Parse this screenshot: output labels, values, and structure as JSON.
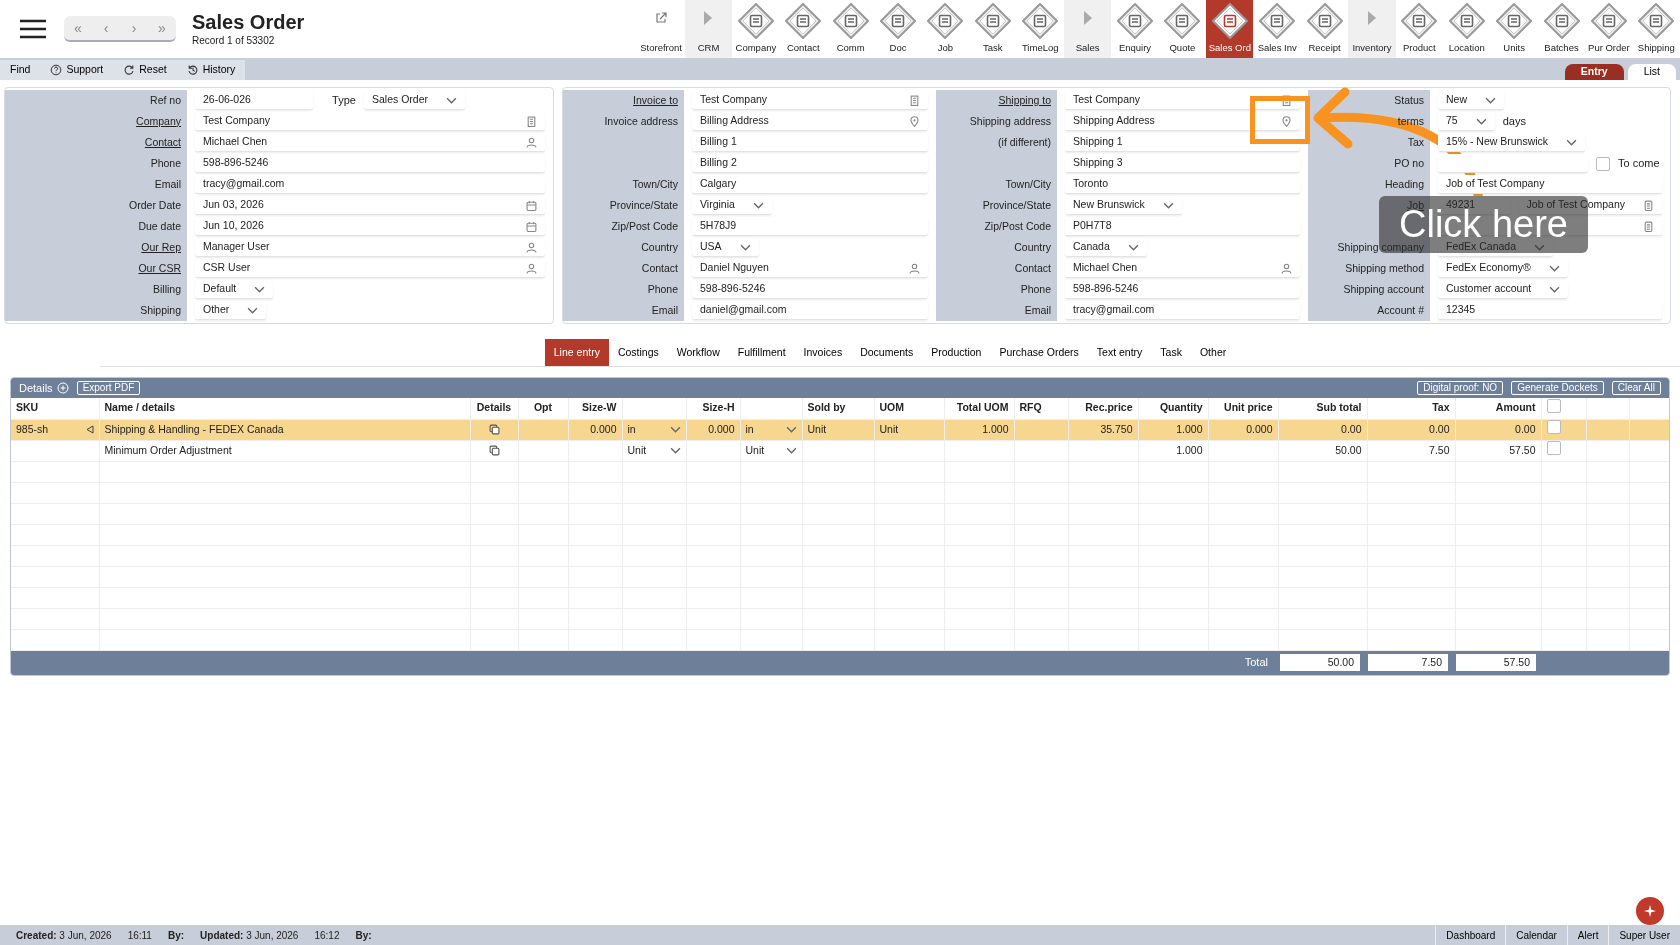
{
  "app": {
    "title": "Sales Order",
    "record": "Record 1 of 53302"
  },
  "nav_buttons": [
    "«",
    "‹",
    "›",
    "»"
  ],
  "toolbar": [
    {
      "label": "Storefront",
      "kind": "link",
      "selected": false
    },
    {
      "label": "CRM",
      "kind": "section",
      "selected": false
    },
    {
      "label": "Company",
      "kind": "module",
      "selected": false
    },
    {
      "label": "Contact",
      "kind": "module",
      "selected": false
    },
    {
      "label": "Comm",
      "kind": "module",
      "selected": false
    },
    {
      "label": "Doc",
      "kind": "module",
      "selected": false
    },
    {
      "label": "Job",
      "kind": "module",
      "selected": false
    },
    {
      "label": "Task",
      "kind": "module",
      "selected": false
    },
    {
      "label": "TimeLog",
      "kind": "module",
      "selected": false
    },
    {
      "label": "Sales",
      "kind": "section",
      "selected": false
    },
    {
      "label": "Enquiry",
      "kind": "module",
      "selected": false
    },
    {
      "label": "Quote",
      "kind": "module",
      "selected": false
    },
    {
      "label": "Sales Ord",
      "kind": "module",
      "selected": true
    },
    {
      "label": "Sales Inv",
      "kind": "module",
      "selected": false
    },
    {
      "label": "Receipt",
      "kind": "module",
      "selected": false
    },
    {
      "label": "Inventory",
      "kind": "section",
      "selected": false
    },
    {
      "label": "Product",
      "kind": "module",
      "selected": false
    },
    {
      "label": "Location",
      "kind": "module",
      "selected": false
    },
    {
      "label": "Units",
      "kind": "module",
      "selected": false
    },
    {
      "label": "Batches",
      "kind": "module",
      "selected": false
    },
    {
      "label": "Pur Order",
      "kind": "module",
      "selected": false
    },
    {
      "label": "Shipping",
      "kind": "module",
      "selected": false
    }
  ],
  "actions": [
    {
      "label": "Find",
      "kind": "plain"
    },
    {
      "label": "Support",
      "kind": "help"
    },
    {
      "label": "Reset",
      "kind": "reset"
    },
    {
      "label": "History",
      "kind": "history"
    }
  ],
  "view_tabs": [
    {
      "label": "Entry",
      "selected": true
    },
    {
      "label": "List",
      "selected": false
    }
  ],
  "form": {
    "general": [
      {
        "label": "Ref no",
        "value": "26-06-026",
        "kind": "text",
        "extra": {
          "label": "Type",
          "value": "Sales Order",
          "kind": "select"
        }
      },
      {
        "label": "Company",
        "link": true,
        "value": "Test Company",
        "kind": "company"
      },
      {
        "label": "Contact",
        "link": true,
        "value": "Michael Chen",
        "kind": "person"
      },
      {
        "label": "Phone",
        "value": "598-896-5246",
        "kind": "text"
      },
      {
        "label": "Email",
        "value": "tracy@gmail.com",
        "kind": "text"
      },
      {
        "label": "Order Date",
        "value": "Jun 03, 2026",
        "kind": "date"
      },
      {
        "label": "Due date",
        "value": "Jun 10, 2026",
        "kind": "date"
      },
      {
        "label": "Our Rep",
        "link": true,
        "value": "Manager User",
        "kind": "person"
      },
      {
        "label": "Our CSR",
        "link": true,
        "value": "CSR User",
        "kind": "person"
      },
      {
        "label": "Billing",
        "value": "Default",
        "kind": "select"
      },
      {
        "label": "Shipping",
        "value": "Other",
        "kind": "select"
      }
    ],
    "invoice": [
      {
        "label": "Invoice to",
        "link": true,
        "value": "Test Company",
        "kind": "company"
      },
      {
        "label": "Invoice address",
        "value": "Billing Address",
        "kind": "address"
      },
      {
        "value": "Billing 1",
        "kind": "text"
      },
      {
        "value": "Billing 2",
        "kind": "text"
      },
      {
        "label": "Town/City",
        "value": "Calgary",
        "kind": "text"
      },
      {
        "label": "Province/State",
        "value": "Virginia",
        "kind": "select"
      },
      {
        "label": "Zip/Post Code",
        "value": "5H78J9",
        "kind": "text"
      },
      {
        "label": "Country",
        "value": "USA",
        "kind": "select"
      },
      {
        "label": "Contact",
        "value": "Daniel Nguyen",
        "kind": "person"
      },
      {
        "label": "Phone",
        "value": "598-896-5246",
        "kind": "text"
      },
      {
        "label": "Email",
        "value": "daniel@gmail.com",
        "kind": "text"
      }
    ],
    "shipping": [
      {
        "label": "Shipping to",
        "link": true,
        "value": "Test Company",
        "kind": "company"
      },
      {
        "label": "Shipping address",
        "value": "Shipping Address",
        "kind": "address"
      },
      {
        "label": "(if different)",
        "value": "Shipping 1",
        "kind": "text"
      },
      {
        "value": "Shipping 3",
        "kind": "text"
      },
      {
        "label": "Town/City",
        "value": "Toronto",
        "kind": "text"
      },
      {
        "label": "Province/State",
        "value": "New Brunswick",
        "kind": "select"
      },
      {
        "label": "Zip/Post Code",
        "value": "P0H7T8",
        "kind": "text"
      },
      {
        "label": "Country",
        "value": "Canada",
        "kind": "select"
      },
      {
        "label": "Contact",
        "value": "Michael Chen",
        "kind": "person"
      },
      {
        "label": "Phone",
        "value": "598-896-5246",
        "kind": "text"
      },
      {
        "label": "Email",
        "value": "tracy@gmail.com",
        "kind": "text"
      }
    ],
    "status": [
      {
        "label": "Status",
        "value": "New",
        "kind": "select"
      },
      {
        "label": "terms",
        "value": "75",
        "kind": "select",
        "suffix": "days"
      },
      {
        "label": "Tax",
        "value": "15% - New Brunswick",
        "kind": "select"
      },
      {
        "label": "PO no",
        "kind": "short",
        "extra": {
          "label": "To come",
          "kind": "checkbox",
          "checked": false
        }
      },
      {
        "label": "Heading",
        "value": "Job of Test Company",
        "kind": "text"
      },
      {
        "label": "Job",
        "link": true,
        "value": "49231",
        "kind": "short",
        "extra": {
          "value": "Job of Test Company",
          "kind": "lookup"
        }
      },
      {
        "kind": "lookup"
      },
      {
        "label": "Shipping company",
        "value": "FedEx Canada",
        "kind": "select"
      },
      {
        "label": "Shipping method",
        "value": "FedEx Economy®",
        "kind": "select"
      },
      {
        "label": "Shipping account",
        "value": "Customer account",
        "kind": "select"
      },
      {
        "label": "Account #",
        "value": "12345",
        "kind": "text"
      }
    ]
  },
  "detail_tabs": [
    {
      "label": "Line entry",
      "selected": true
    },
    {
      "label": "Costings",
      "selected": false
    },
    {
      "label": "Workflow",
      "selected": false
    },
    {
      "label": "Fulfillment",
      "selected": false
    },
    {
      "label": "Invoices",
      "selected": false
    },
    {
      "label": "Documents",
      "selected": false
    },
    {
      "label": "Production",
      "selected": false
    },
    {
      "label": "Purchase Orders",
      "selected": false
    },
    {
      "label": "Text entry",
      "selected": false
    },
    {
      "label": "Task",
      "selected": false
    },
    {
      "label": "Other",
      "selected": false
    }
  ],
  "details": {
    "title": "Details",
    "export": "Export PDF",
    "buttons": [
      "Digital proof: NO",
      "Generate Dockets",
      "Clear All"
    ],
    "columns": [
      {
        "label": "SKU",
        "kind": "text"
      },
      {
        "label": "Name / details",
        "kind": "text"
      },
      {
        "label": "Details",
        "kind": "icon"
      },
      {
        "label": "Opt",
        "kind": "icon"
      },
      {
        "label": "Size-W",
        "kind": "number"
      },
      {
        "kind": "text"
      },
      {
        "label": "Size-H",
        "kind": "number"
      },
      {
        "kind": "text"
      },
      {
        "label": "Sold by",
        "kind": "text"
      },
      {
        "label": "UOM",
        "kind": "text"
      },
      {
        "label": "Total UOM",
        "kind": "number"
      },
      {
        "label": "RFQ",
        "kind": "text"
      },
      {
        "label": "Rec.price",
        "kind": "number"
      },
      {
        "label": "Quantity",
        "kind": "number"
      },
      {
        "label": "Unit price",
        "kind": "number"
      },
      {
        "label": "Sub total",
        "kind": "number"
      },
      {
        "label": "Tax",
        "kind": "number"
      },
      {
        "label": "Amount",
        "kind": "number"
      },
      {
        "kind": "check",
        "checked": false
      }
    ],
    "rows": [
      {
        "selected": true,
        "cells": [
          {
            "value": "985-sh",
            "flag": true
          },
          {
            "value": "Shipping & Handling - FEDEX Canada"
          },
          {
            "kind": "copy"
          },
          {},
          {
            "value": "0.000"
          },
          {
            "value": "in",
            "kind": "select"
          },
          {
            "value": "0.000"
          },
          {
            "value": "in",
            "kind": "select"
          },
          {
            "value": "Unit"
          },
          {
            "value": "Unit"
          },
          {
            "value": "1.000"
          },
          {},
          {
            "value": "35.750"
          },
          {
            "value": "1.000"
          },
          {
            "value": "0.000"
          },
          {
            "value": "0.00"
          },
          {
            "value": "0.00"
          },
          {
            "value": "0.00"
          },
          {
            "kind": "check",
            "checked": false
          }
        ]
      },
      {
        "selected": false,
        "cells": [
          {},
          {
            "value": "Minimum Order Adjustment"
          },
          {
            "kind": "copy"
          },
          {},
          {},
          {
            "value": "Unit",
            "kind": "select"
          },
          {},
          {
            "value": "Unit",
            "kind": "select"
          },
          {},
          {},
          {},
          {},
          {},
          {
            "value": "1.000"
          },
          {},
          {
            "value": "50.00"
          },
          {
            "value": "7.50"
          },
          {
            "value": "57.50"
          },
          {
            "kind": "check",
            "checked": false
          }
        ]
      }
    ],
    "totals": {
      "label": "Total",
      "values": [
        "50.00",
        "7.50",
        "57.50"
      ]
    }
  },
  "status_bar": {
    "items": [
      {
        "label": "Created:",
        "value": "3 Jun, 2026"
      },
      {
        "value": "16:11"
      },
      {
        "label": "By:"
      },
      {
        "label": "Updated:",
        "value": "3 Jun, 2026"
      },
      {
        "value": "16:12"
      },
      {
        "label": "By:"
      }
    ],
    "links": [
      "Dashboard",
      "Calendar",
      "Alert",
      "Super User"
    ]
  },
  "callout": {
    "text": "Click here"
  }
}
